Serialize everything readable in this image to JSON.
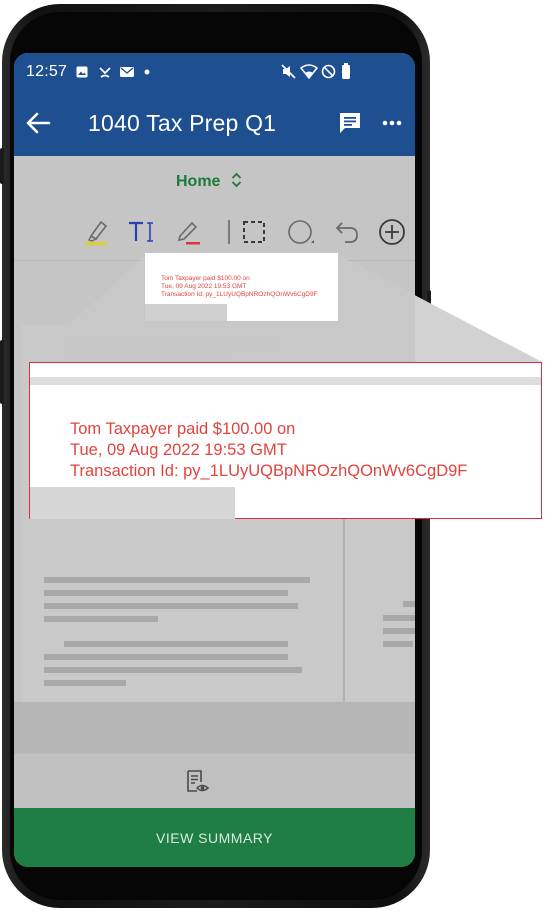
{
  "status_bar": {
    "time": "12:57",
    "left_icons": [
      "image-icon",
      "missed-call-icon",
      "mail-icon",
      "dot-icon"
    ],
    "right_icons": [
      "mute-icon",
      "wifi-icon",
      "do-not-disturb-icon",
      "battery-icon"
    ]
  },
  "app_bar": {
    "back_icon": "arrow-left-icon",
    "title": "1040 Tax Prep Q1",
    "comment_icon": "comment-icon",
    "more_icon": "more-horizontal-icon"
  },
  "mode_selector": {
    "label": "Home",
    "icon": "chevron-up-down-icon"
  },
  "toolbar": {
    "tools": [
      "highlighter-icon",
      "text-tool-icon",
      "pen-icon",
      "selection-rect-icon",
      "circle-shape-icon",
      "undo-icon",
      "add-icon"
    ],
    "colors": {
      "highlighter": "#e0d02a",
      "text": "#2b3fb8",
      "pen": "#d23b32"
    }
  },
  "annotation": {
    "line1": "Tom Taxpayer paid $100.00 on",
    "line2": "Tue, 09 Aug 2022 19:53 GMT",
    "line3": "Transaction Id: py_1LUyUQBpNROzhQOnWv6CgD9F"
  },
  "bottom": {
    "preview_icon": "document-preview-icon",
    "summary_button": "VIEW SUMMARY"
  },
  "colors": {
    "app_bar": "#1e4f91",
    "accent_green": "#1e7e44",
    "annotation_red": "#e0443e"
  }
}
